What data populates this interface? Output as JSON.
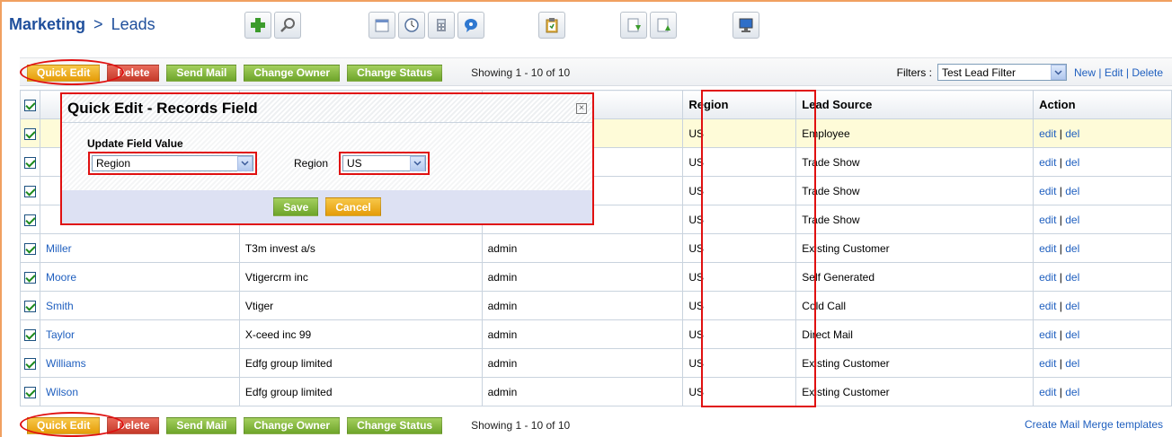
{
  "breadcrumb": {
    "module": "Marketing",
    "separator": ">",
    "page": "Leads"
  },
  "toolbar_icons": [
    "add-icon",
    "search-icon",
    "calendar-icon",
    "clock-icon",
    "calculator-icon",
    "chat-icon",
    "clipboard-icon",
    "import-icon",
    "export-icon",
    "monitor-icon"
  ],
  "actions": {
    "quick_edit": "Quick Edit",
    "delete": "Delete",
    "send_mail": "Send Mail",
    "change_owner": "Change Owner",
    "change_status": "Change Status",
    "showing": "Showing 1 - 10 of 10"
  },
  "filters": {
    "label": "Filters :",
    "selected": "Test Lead Filter",
    "new": "New",
    "edit": "Edit",
    "delete": "Delete",
    "sep": "|"
  },
  "table": {
    "headers": {
      "region": "Region",
      "lead_source": "Lead Source",
      "action": "Action"
    },
    "rows": [
      {
        "last_name": "",
        "company": "",
        "owner": "",
        "region": "US",
        "lead_source": "Employee",
        "edit": "edit",
        "del": "del"
      },
      {
        "last_name": "",
        "company": "",
        "owner": "",
        "region": "US",
        "lead_source": "Trade Show",
        "edit": "edit",
        "del": "del"
      },
      {
        "last_name": "",
        "company": "",
        "owner": "",
        "region": "US",
        "lead_source": "Trade Show",
        "edit": "edit",
        "del": "del"
      },
      {
        "last_name": "",
        "company": "",
        "owner": "",
        "region": "US",
        "lead_source": "Trade Show",
        "edit": "edit",
        "del": "del"
      },
      {
        "last_name": "Miller",
        "company": "T3m invest a/s",
        "owner": "admin",
        "region": "US",
        "lead_source": "Existing Customer",
        "edit": "edit",
        "del": "del"
      },
      {
        "last_name": "Moore",
        "company": "Vtigercrm inc",
        "owner": "admin",
        "region": "US",
        "lead_source": "Self Generated",
        "edit": "edit",
        "del": "del"
      },
      {
        "last_name": "Smith",
        "company": "Vtiger",
        "owner": "admin",
        "region": "US",
        "lead_source": "Cold Call",
        "edit": "edit",
        "del": "del"
      },
      {
        "last_name": "Taylor",
        "company": "X-ceed inc 99",
        "owner": "admin",
        "region": "US",
        "lead_source": "Direct Mail",
        "edit": "edit",
        "del": "del"
      },
      {
        "last_name": "Williams",
        "company": "Edfg group limited",
        "owner": "admin",
        "region": "US",
        "lead_source": "Existing Customer",
        "edit": "edit",
        "del": "del"
      },
      {
        "last_name": "Wilson",
        "company": "Edfg group limited",
        "owner": "admin",
        "region": "US",
        "lead_source": "Existing Customer",
        "edit": "edit",
        "del": "del"
      }
    ]
  },
  "quick_edit_modal": {
    "title": "Quick Edit - Records Field",
    "section_label": "Update Field Value",
    "field_selected": "Region",
    "value_label": "Region",
    "value_selected": "US",
    "save": "Save",
    "cancel": "Cancel"
  },
  "footer": {
    "merge_link": "Create Mail Merge templates"
  },
  "colors": {
    "highlight": "#e01010",
    "link": "#1f5fbf",
    "title": "#1f4f9c"
  }
}
